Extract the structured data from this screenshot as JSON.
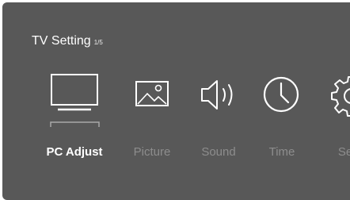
{
  "header": {
    "title": "TV Setting",
    "page_indicator": "1/5"
  },
  "menu": {
    "items": [
      {
        "label": "PC Adjust",
        "icon": "monitor-icon",
        "selected": true
      },
      {
        "label": "Picture",
        "icon": "picture-icon",
        "selected": false
      },
      {
        "label": "Sound",
        "icon": "speaker-icon",
        "selected": false
      },
      {
        "label": "Time",
        "icon": "clock-icon",
        "selected": false
      },
      {
        "label": "Se",
        "icon": "gear-icon",
        "selected": false
      }
    ]
  },
  "colors": {
    "panel_background": "#585858",
    "selected_text": "#ffffff",
    "unselected_text": "#8d8d8d",
    "icon_stroke": "#ffffff"
  }
}
